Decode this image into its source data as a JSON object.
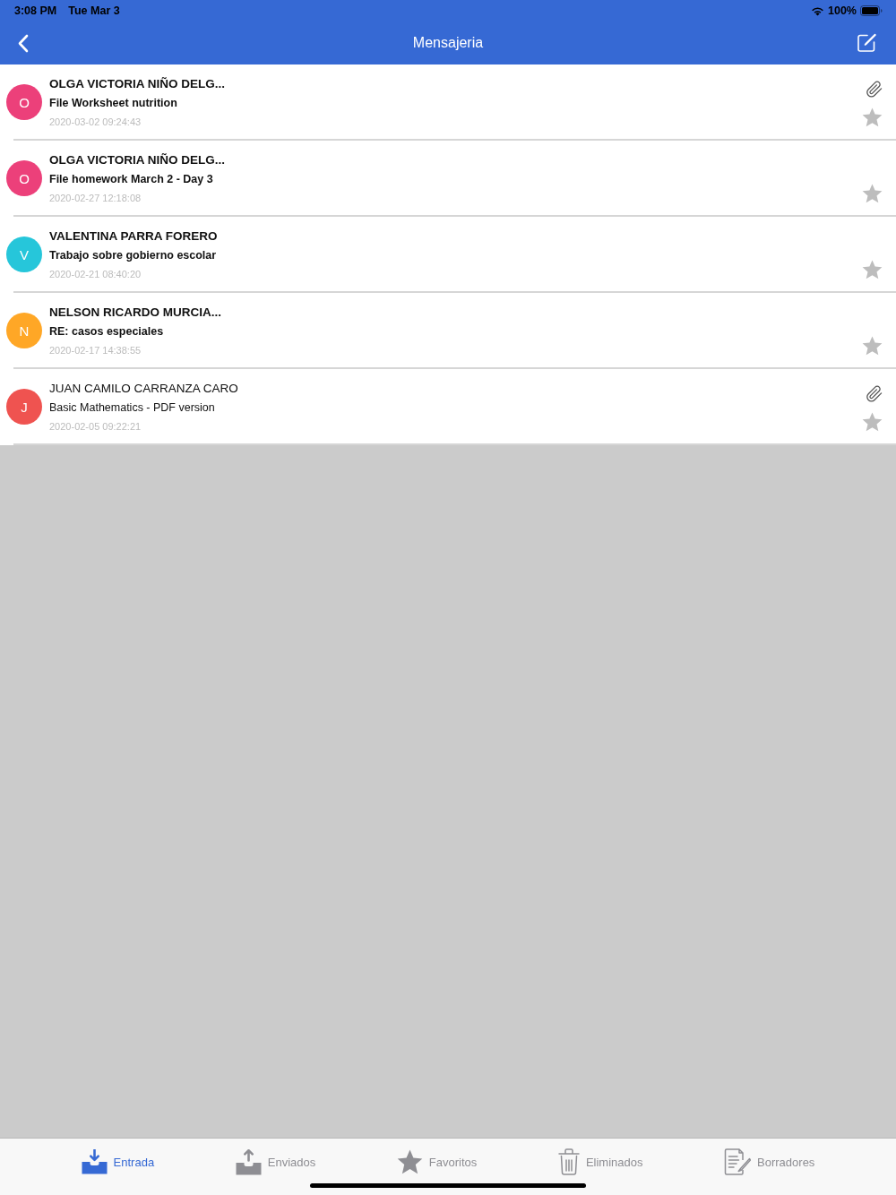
{
  "status_bar": {
    "time": "3:08 PM",
    "date": "Tue Mar 3",
    "battery": "100%"
  },
  "nav_bar": {
    "title": "Mensajeria"
  },
  "messages": [
    {
      "initial": "O",
      "color": "#ec407a",
      "sender": "OLGA VICTORIA NIÑO DELG...",
      "subject": "File Worksheet nutrition",
      "date": "2020-03-02 09:24:43",
      "unread": true,
      "attachment": true,
      "starred": false
    },
    {
      "initial": "O",
      "color": "#ec407a",
      "sender": "OLGA VICTORIA NIÑO DELG...",
      "subject": "File homework March 2 - Day 3",
      "date": "2020-02-27 12:18:08",
      "unread": true,
      "attachment": false,
      "starred": false
    },
    {
      "initial": "V",
      "color": "#26c6da",
      "sender": "VALENTINA PARRA FORERO",
      "subject": "Trabajo sobre gobierno escolar",
      "date": "2020-02-21 08:40:20",
      "unread": true,
      "attachment": false,
      "starred": false
    },
    {
      "initial": "N",
      "color": "#ffa726",
      "sender": "NELSON RICARDO MURCIA...",
      "subject": "RE: casos especiales",
      "date": "2020-02-17 14:38:55",
      "unread": true,
      "attachment": false,
      "starred": false
    },
    {
      "initial": "J",
      "color": "#ef5350",
      "sender": "JUAN CAMILO CARRANZA CARO",
      "subject": "Basic Mathematics - PDF version",
      "date": "2020-02-05 09:22:21",
      "unread": false,
      "attachment": true,
      "starred": false
    }
  ],
  "tab_bar": {
    "tabs": [
      {
        "kind": "inbox",
        "label": "Entrada",
        "selected": true
      },
      {
        "kind": "sent",
        "label": "Enviados",
        "selected": false
      },
      {
        "kind": "favorites",
        "label": "Favoritos",
        "selected": false
      },
      {
        "kind": "trash",
        "label": "Eliminados",
        "selected": false
      },
      {
        "kind": "drafts",
        "label": "Borradores",
        "selected": false
      }
    ]
  }
}
